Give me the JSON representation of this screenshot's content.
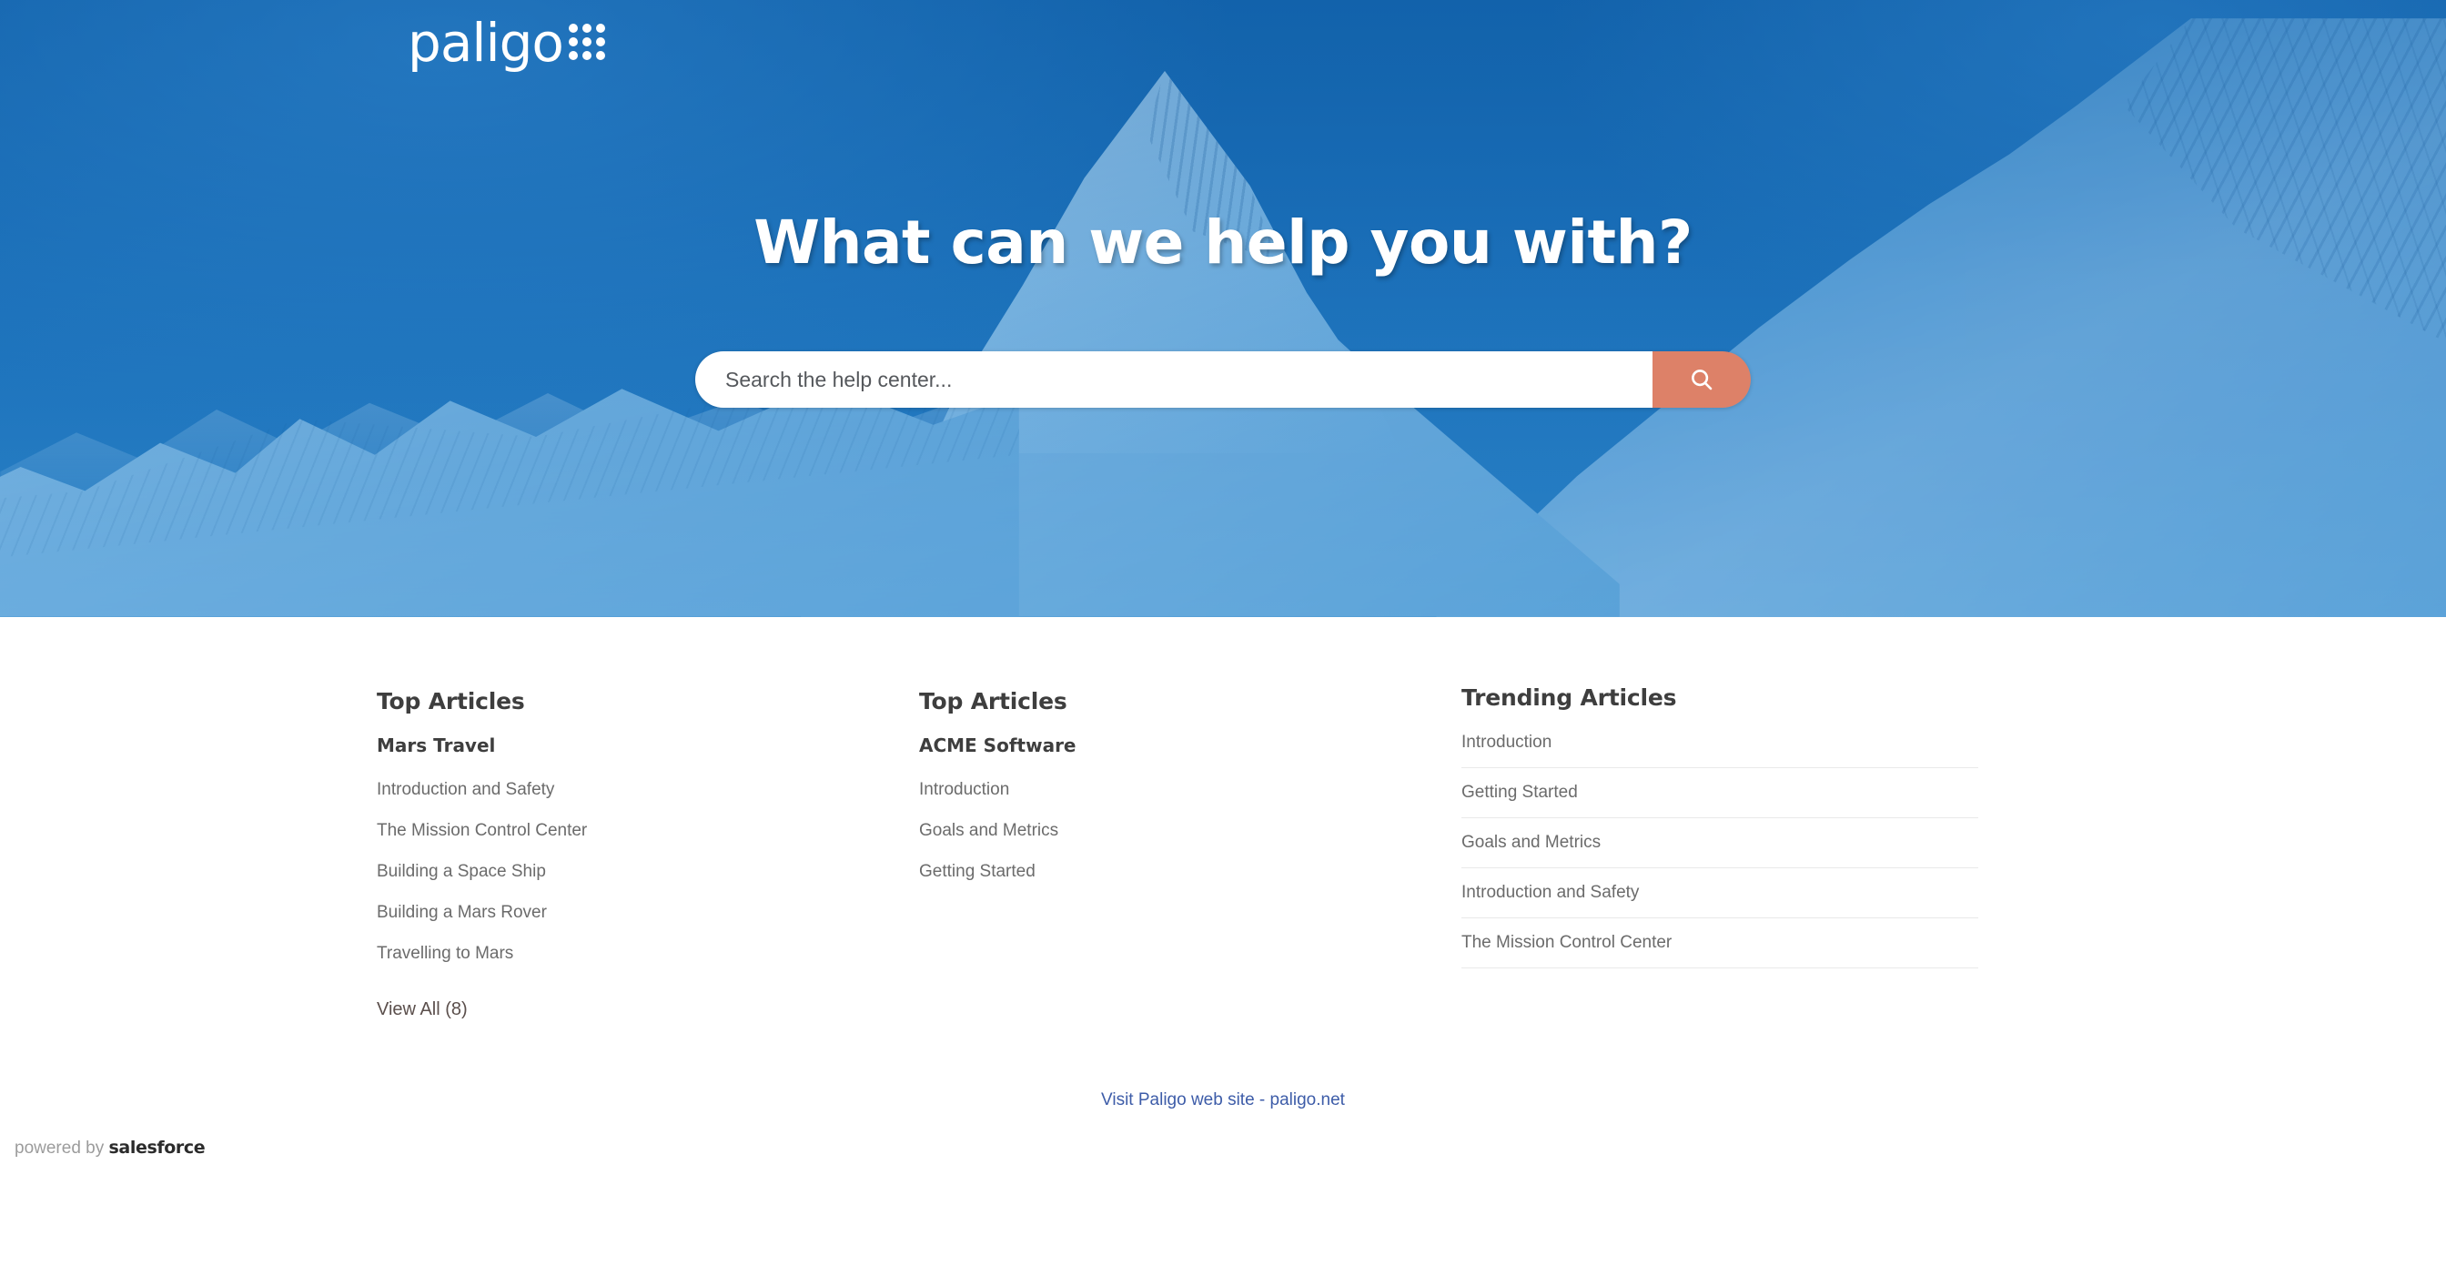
{
  "brand": {
    "logo_word": "paligo",
    "logo_icon": "grid-dots-icon",
    "hero_bg_color": "#1a6cb5",
    "accent_color": "#dd8168",
    "link_color": "#3d5ca8"
  },
  "hero": {
    "title": "What can we help you with?",
    "search": {
      "placeholder": "Search the help center...",
      "value": "",
      "button_icon": "search-icon"
    }
  },
  "main": {
    "columns": [
      {
        "heading": "Top Articles",
        "category": "Mars Travel",
        "articles": [
          "Introduction and Safety",
          "The Mission Control Center",
          "Building a Space Ship",
          "Building a Mars Rover",
          "Travelling to Mars"
        ],
        "view_all": "View All (8)"
      },
      {
        "heading": "Top Articles",
        "category": "ACME Software",
        "articles": [
          "Introduction",
          "Goals and Metrics",
          "Getting Started"
        ]
      },
      {
        "heading": "Trending Articles",
        "articles": [
          "Introduction",
          "Getting Started",
          "Goals and Metrics",
          "Introduction and Safety",
          "The Mission Control Center"
        ]
      }
    ]
  },
  "footer": {
    "visit_link": "Visit Paligo web site - paligo.net",
    "powered_by_prefix": "powered by",
    "powered_by_brand": "salesforce"
  }
}
